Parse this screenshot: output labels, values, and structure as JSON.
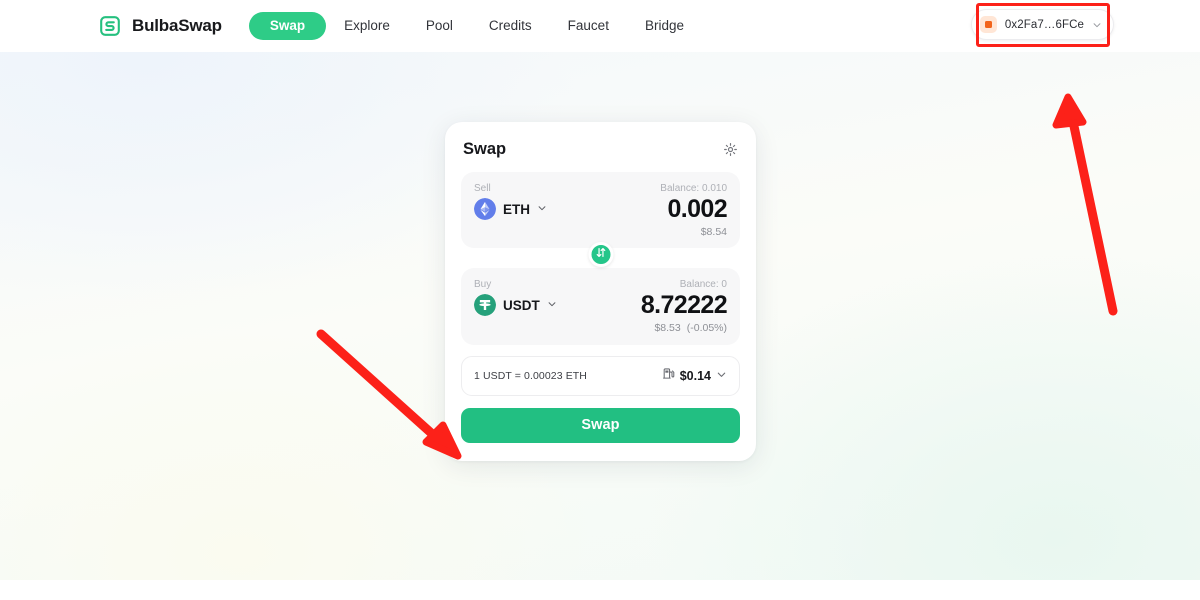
{
  "header": {
    "brand_name": "BulbaSwap",
    "logo_icon": "bulbaswap-logo-icon",
    "nav": [
      {
        "label": "Swap",
        "active": true
      },
      {
        "label": "Explore",
        "active": false
      },
      {
        "label": "Pool",
        "active": false
      },
      {
        "label": "Credits",
        "active": false
      },
      {
        "label": "Faucet",
        "active": false
      },
      {
        "label": "Bridge",
        "active": false
      }
    ],
    "wallet": {
      "address": "0x2Fa7…6FCe",
      "icon": "wallet-square-icon",
      "chevron_icon": "chevron-down-icon"
    }
  },
  "swap_card": {
    "title": "Swap",
    "settings_icon": "gear-icon",
    "sell": {
      "label": "Sell",
      "balance": "Balance: 0.010",
      "token_symbol": "ETH",
      "token_icon": "eth-token-icon",
      "chevron_icon": "chevron-down-icon",
      "amount": "0.002",
      "fiat": "$8.54"
    },
    "switch_icon": "swap-direction-icon",
    "buy": {
      "label": "Buy",
      "balance": "Balance: 0",
      "token_symbol": "USDT",
      "token_icon": "usdt-token-icon",
      "chevron_icon": "chevron-down-icon",
      "amount": "8.72222",
      "fiat": "$8.53",
      "percent": "(-0.05%)"
    },
    "rate": {
      "text": "1 USDT = 0.00023 ETH",
      "gas_icon": "gas-pump-icon",
      "gas_value": "$0.14",
      "chevron_icon": "chevron-down-icon"
    },
    "action_label": "Swap"
  },
  "annotations": {
    "highlight_color": "#fc2119",
    "box_target": "wallet-button",
    "arrow_right_target": "wallet-button",
    "arrow_left_target": "swap-action-button"
  },
  "colors": {
    "brand_green": "#2ecc87",
    "action_green": "#22bf82",
    "eth_blue": "#627eea",
    "usdt_green": "#26a17b",
    "wallet_orange": "#f2641b"
  }
}
